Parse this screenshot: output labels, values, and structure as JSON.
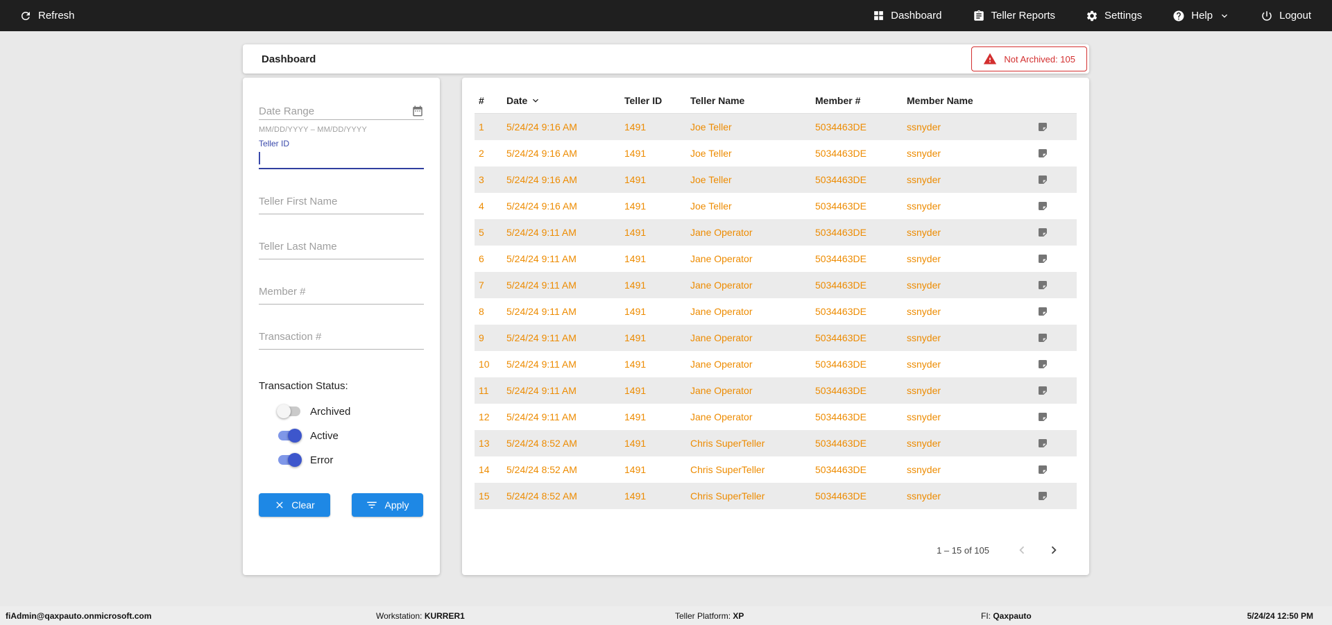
{
  "top_nav": {
    "refresh_label": "Refresh",
    "items": [
      {
        "label": "Dashboard",
        "icon": "dashboard-icon"
      },
      {
        "label": "Teller Reports",
        "icon": "teller-reports-icon"
      },
      {
        "label": "Settings",
        "icon": "settings-icon"
      },
      {
        "label": "Help",
        "icon": "help-icon",
        "has_dropdown": true
      },
      {
        "label": "Logout",
        "icon": "logout-icon"
      }
    ]
  },
  "header": {
    "title": "Dashboard",
    "alert": {
      "label": "Not Archived: 105",
      "icon": "warning-icon"
    }
  },
  "filters": {
    "date_range": {
      "placeholder": "Date Range",
      "hint": "MM/DD/YYYY – MM/DD/YYYY",
      "icon": "calendar-icon",
      "value": ""
    },
    "teller_id": {
      "label": "Teller ID",
      "value": "",
      "focused": true
    },
    "teller_first_name": {
      "placeholder": "Teller First Name",
      "value": ""
    },
    "teller_last_name": {
      "placeholder": "Teller Last Name",
      "value": ""
    },
    "member_number": {
      "placeholder": "Member #",
      "value": ""
    },
    "transaction_number": {
      "placeholder": "Transaction #",
      "value": ""
    },
    "status": {
      "label": "Transaction Status:",
      "toggles": [
        {
          "label": "Archived",
          "on": false
        },
        {
          "label": "Active",
          "on": true
        },
        {
          "label": "Error",
          "on": true
        }
      ]
    },
    "clear_label": "Clear",
    "apply_label": "Apply"
  },
  "table": {
    "columns": [
      "#",
      "Date",
      "Teller ID",
      "Teller Name",
      "Member #",
      "Member Name"
    ],
    "sort_column": "Date",
    "sort_direction": "desc",
    "rows": [
      {
        "num": "1",
        "date": "5/24/24 9:16 AM",
        "teller_id": "1491",
        "teller_name": "Joe Teller",
        "member_number": "5034463DE",
        "member_name": "ssnyder"
      },
      {
        "num": "2",
        "date": "5/24/24 9:16 AM",
        "teller_id": "1491",
        "teller_name": "Joe Teller",
        "member_number": "5034463DE",
        "member_name": "ssnyder"
      },
      {
        "num": "3",
        "date": "5/24/24 9:16 AM",
        "teller_id": "1491",
        "teller_name": "Joe Teller",
        "member_number": "5034463DE",
        "member_name": "ssnyder"
      },
      {
        "num": "4",
        "date": "5/24/24 9:16 AM",
        "teller_id": "1491",
        "teller_name": "Joe Teller",
        "member_number": "5034463DE",
        "member_name": "ssnyder"
      },
      {
        "num": "5",
        "date": "5/24/24 9:11 AM",
        "teller_id": "1491",
        "teller_name": "Jane Operator",
        "member_number": "5034463DE",
        "member_name": "ssnyder"
      },
      {
        "num": "6",
        "date": "5/24/24 9:11 AM",
        "teller_id": "1491",
        "teller_name": "Jane Operator",
        "member_number": "5034463DE",
        "member_name": "ssnyder"
      },
      {
        "num": "7",
        "date": "5/24/24 9:11 AM",
        "teller_id": "1491",
        "teller_name": "Jane Operator",
        "member_number": "5034463DE",
        "member_name": "ssnyder"
      },
      {
        "num": "8",
        "date": "5/24/24 9:11 AM",
        "teller_id": "1491",
        "teller_name": "Jane Operator",
        "member_number": "5034463DE",
        "member_name": "ssnyder"
      },
      {
        "num": "9",
        "date": "5/24/24 9:11 AM",
        "teller_id": "1491",
        "teller_name": "Jane Operator",
        "member_number": "5034463DE",
        "member_name": "ssnyder"
      },
      {
        "num": "10",
        "date": "5/24/24 9:11 AM",
        "teller_id": "1491",
        "teller_name": "Jane Operator",
        "member_number": "5034463DE",
        "member_name": "ssnyder"
      },
      {
        "num": "11",
        "date": "5/24/24 9:11 AM",
        "teller_id": "1491",
        "teller_name": "Jane Operator",
        "member_number": "5034463DE",
        "member_name": "ssnyder"
      },
      {
        "num": "12",
        "date": "5/24/24 9:11 AM",
        "teller_id": "1491",
        "teller_name": "Jane Operator",
        "member_number": "5034463DE",
        "member_name": "ssnyder"
      },
      {
        "num": "13",
        "date": "5/24/24 8:52 AM",
        "teller_id": "1491",
        "teller_name": "Chris SuperTeller",
        "member_number": "5034463DE",
        "member_name": "ssnyder"
      },
      {
        "num": "14",
        "date": "5/24/24 8:52 AM",
        "teller_id": "1491",
        "teller_name": "Chris SuperTeller",
        "member_number": "5034463DE",
        "member_name": "ssnyder"
      },
      {
        "num": "15",
        "date": "5/24/24 8:52 AM",
        "teller_id": "1491",
        "teller_name": "Chris SuperTeller",
        "member_number": "5034463DE",
        "member_name": "ssnyder"
      }
    ],
    "pagination": {
      "range_label": "1 – 15 of 105"
    }
  },
  "footer": {
    "user": "fiAdmin@qaxpauto.onmicrosoft.com",
    "workstation_label": "Workstation:",
    "workstation_value": "KURRER1",
    "platform_label": "Teller Platform:",
    "platform_value": "XP",
    "fi_label": "FI:",
    "fi_value": "Qaxpauto",
    "datetime": "5/24/24 12:50 PM"
  },
  "colors": {
    "topbar_bg": "#1f1f1f",
    "page_bg": "#e9e9e9",
    "accent_blue": "#1e88e5",
    "focus_indigo": "#303f9f",
    "row_text_orange": "#ED8B00",
    "alert_red": "#d32f2f",
    "stripe_gray": "#ebebeb"
  }
}
